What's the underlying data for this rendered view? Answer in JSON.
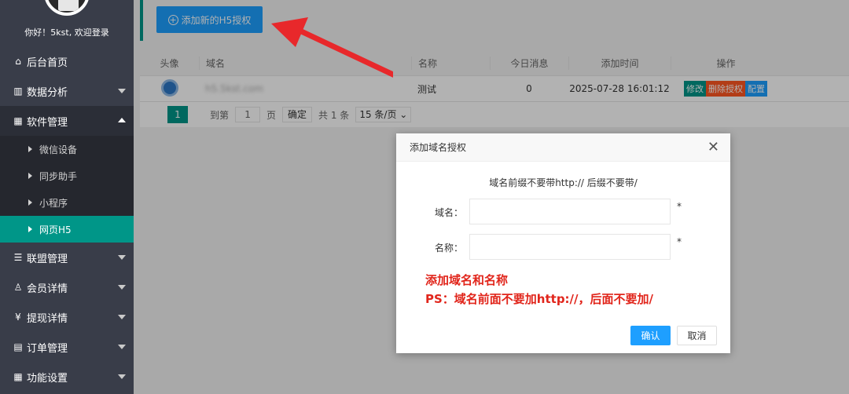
{
  "sidebar": {
    "greeting": "你好！5kst, 欢迎登录",
    "menu": [
      {
        "label": "后台首页",
        "icon": "home-icon"
      },
      {
        "label": "数据分析",
        "icon": "chart-icon"
      },
      {
        "label": "软件管理",
        "icon": "grid-icon"
      },
      {
        "label": "联盟管理",
        "icon": "list-icon"
      },
      {
        "label": "会员详情",
        "icon": "user-icon"
      },
      {
        "label": "提现详情",
        "icon": "yen-icon"
      },
      {
        "label": "订单管理",
        "icon": "table-icon"
      },
      {
        "label": "功能设置",
        "icon": "settings-icon"
      }
    ],
    "submenu": [
      "微信设备",
      "同步助手",
      "小程序",
      "网页H5"
    ]
  },
  "toolbar": {
    "add_label": "添加新的H5授权"
  },
  "table": {
    "headers": [
      "头像",
      "域名",
      "名称",
      "今日消息",
      "添加时间",
      "操作"
    ],
    "row": {
      "domain": "h5.5kst.com",
      "name": "测试",
      "today_msgs": "0",
      "added": "2025-07-28 16:01:12",
      "edit": "修改",
      "delete": "删除授权",
      "config": "配置"
    }
  },
  "pager": {
    "page": "1",
    "goto_label": "到第",
    "goto_value": "1",
    "page_suffix": "页",
    "confirm": "确定",
    "total": "共 1 条",
    "page_size": "15 条/页"
  },
  "dialog": {
    "title": "添加域名授权",
    "tip": "域名前缀不要带http:// 后缀不要带/",
    "domain_label": "域名：",
    "name_label": "名称：",
    "required": "*",
    "note1": "添加域名和名称",
    "note2": "PS：域名前面不要加http://，后面不要加/",
    "ok": "确认",
    "cancel": "取消"
  }
}
